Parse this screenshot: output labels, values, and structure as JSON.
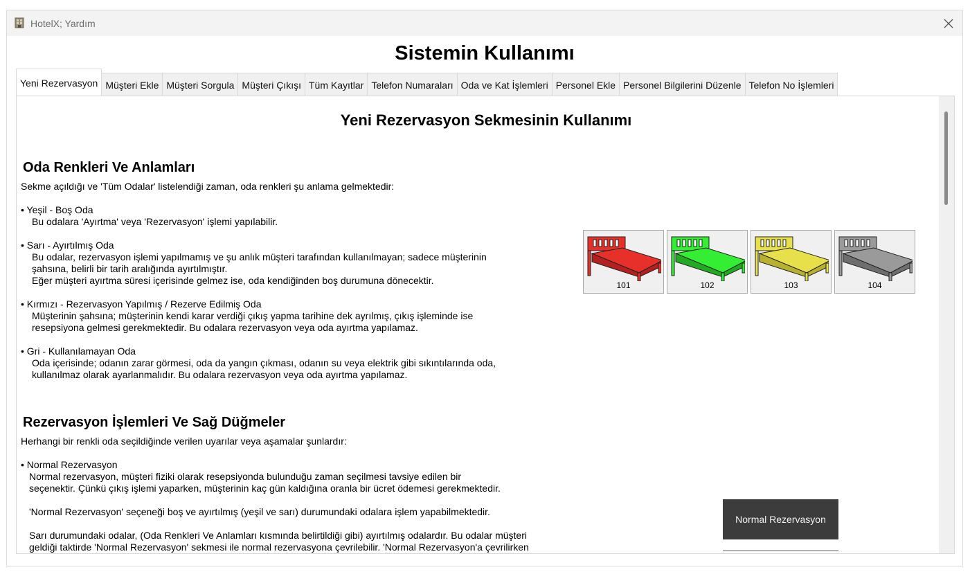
{
  "window": {
    "title": "HotelX; Yardım"
  },
  "main_title": "Sistemin Kullanımı",
  "tabs": [
    {
      "label": "Yeni Rezervasyon",
      "active": true
    },
    {
      "label": "Müşteri Ekle"
    },
    {
      "label": "Müşteri Sorgula"
    },
    {
      "label": "Müşteri Çıkışı"
    },
    {
      "label": "Tüm Kayıtlar"
    },
    {
      "label": "Telefon Numaraları"
    },
    {
      "label": "Oda ve Kat İşlemleri"
    },
    {
      "label": "Personel Ekle"
    },
    {
      "label": "Personel Bilgilerini Düzenle"
    },
    {
      "label": "Telefon No İşlemleri"
    }
  ],
  "content": {
    "title": "Yeni Rezervasyon Sekmesinin Kullanımı",
    "section1": {
      "heading": "Oda Renkleri Ve Anlamları",
      "intro": "Sekme açıldığı ve 'Tüm Odalar' listelendiği zaman, oda renkleri şu anlama gelmektedir:",
      "items": [
        {
          "title": "• Yeşil - Boş Oda",
          "lines": [
            "Bu odalara 'Ayırtma' veya 'Rezervasyon' işlemi yapılabilir."
          ]
        },
        {
          "title": "• Sarı - Ayırtılmış Oda",
          "lines": [
            "Bu odalar, rezervasyon işlemi yapılmamış ve şu anlık müşteri tarafından kullanılmayan; sadece müşterinin",
            "şahsına, belirli bir tarih aralığında ayırtılmıştır.",
            "Eğer müşteri ayırtma süresi içerisinde gelmez ise, oda kendiğinden boş durumuna dönecektir."
          ]
        },
        {
          "title": "• Kırmızı - Rezervasyon Yapılmış / Rezerve Edilmiş Oda",
          "lines": [
            "Müşterinin şahsına; müşterinin kendi karar verdiği çıkış yapma tarihine dek ayrılmış, çıkış işleminde ise",
            "resepsiyona gelmesi gerekmektedir. Bu odalara rezervasyon veya oda ayırtma yapılamaz."
          ]
        },
        {
          "title": "• Gri - Kullanılamayan Oda",
          "lines": [
            "Oda içerisinde; odanın zarar görmesi, oda da yangın çıkması, odanın su veya elektrik gibi sıkıntılarında oda,",
            "kullanılmaz olarak ayarlanmalıdır. Bu odalara rezervasyon veya oda ayırtma yapılamaz."
          ]
        }
      ],
      "rooms": [
        {
          "number": "101",
          "color": "#e8302a",
          "icon": "bed-red-icon"
        },
        {
          "number": "102",
          "color": "#33ee33",
          "icon": "bed-green-icon"
        },
        {
          "number": "103",
          "color": "#e8e04a",
          "icon": "bed-yellow-icon"
        },
        {
          "number": "104",
          "color": "#9a9a9a",
          "icon": "bed-gray-icon"
        }
      ]
    },
    "section2": {
      "heading": "Rezervasyon İşlemleri Ve Sağ Düğmeler",
      "intro": "Herhangi bir renkli oda seçildiğinde verilen uyarılar veya aşamalar şunlardır:",
      "item_title": "• Normal Rezervasyon",
      "lines": [
        "Normal rezervasyon, müşteri fiziki olarak resepsiyonda bulunduğu zaman seçilmesi tavsiye edilen bir",
        "seçenektir. Çünkü çıkış işlemi yaparken, müşterinin kaç gün kaldığına oranla bir ücret ödemesi gerekmektedir.",
        "",
        "'Normal Rezervasyon' seçeneği boş ve ayırtılmış (yeşil ve sarı) durumundaki odalara işlem yapabilmektedir.",
        "",
        "Sarı durumundaki odalar, (Oda Renkleri Ve Anlamları kısmında belirtildiği gibi) ayırtılmış odalardır. Bu odalar müşteri",
        "geldiği taktirde 'Normal Rezervasyon'  sekmesi ile normal rezervasyona çevrilebilir. 'Normal Rezervasyon'a çevrilirken"
      ],
      "button_label": "Normal Rezervasyon"
    }
  }
}
